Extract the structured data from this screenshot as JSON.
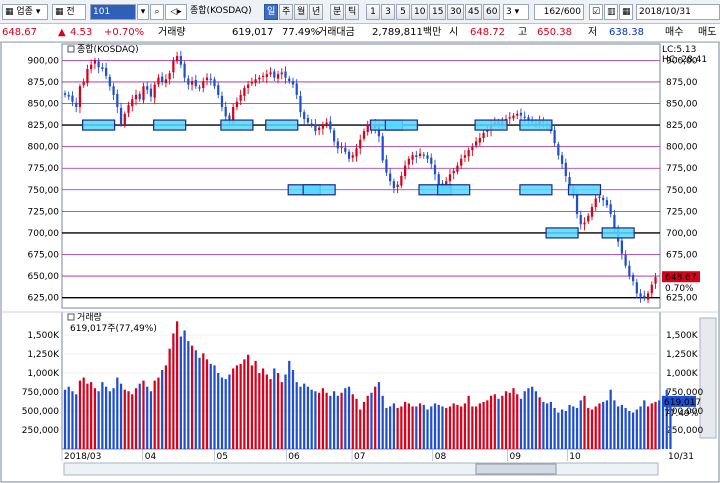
{
  "toolbar": {
    "item1": "업종",
    "item2": "전",
    "code": "101",
    "name": "종합(KOSDAQ)",
    "mode_day": "일",
    "mode_week": "주",
    "mode_month": "월",
    "mode_year": "년",
    "mode_min": "분",
    "mode_tick": "틱",
    "periods": [
      "1",
      "3",
      "5",
      "10",
      "15",
      "30",
      "45",
      "60"
    ],
    "period_select": "3",
    "count": "162",
    "count_total": "/600",
    "date": "2018/10/31"
  },
  "infobar": {
    "price": "648.67",
    "change": "4.53",
    "change_pct": "+0.70%",
    "volume_label": "거래량",
    "volume": "619,017",
    "volume_ratio": "77.49%",
    "amount_label": "거래대금",
    "amount": "2,789,811백만",
    "open_label": "시",
    "open": "648.72",
    "high_label": "고",
    "high": "650.38",
    "low_label": "저",
    "low": "638.38",
    "buy_label": "매수",
    "sell_label": "매도"
  },
  "chart_data": {
    "type": "candlestick",
    "price_panel": {
      "legend": "종합(KOSDAQ)",
      "lc": "LC:5.13",
      "hc": "HC:-28.41",
      "yticks": [
        900,
        875,
        850,
        825,
        800,
        775,
        750,
        725,
        700,
        675,
        650,
        625
      ],
      "ytick_labels": [
        "900,00",
        "875,00",
        "850,00",
        "825,00",
        "800,00",
        "775,00",
        "750,00",
        "725,00",
        "700,00",
        "675,00",
        "650,00",
        "625,00"
      ],
      "ylim": [
        613,
        912
      ],
      "current_price_label": "648.67",
      "current_change_label": "0.70%",
      "support_lines": [
        825,
        700,
        625
      ],
      "grid_lines": [
        900,
        875,
        850,
        800,
        775,
        750,
        725,
        675,
        650
      ],
      "boxes": [
        {
          "center_x": 38,
          "level": 825
        },
        {
          "center_x": 117,
          "level": 825
        },
        {
          "center_x": 189,
          "level": 825
        },
        {
          "center_x": 240,
          "level": 825
        },
        {
          "center_x": 264,
          "level": 750
        },
        {
          "center_x": 284,
          "level": 750
        },
        {
          "center_x": 356,
          "level": 825
        },
        {
          "center_x": 374,
          "level": 825
        },
        {
          "center_x": 410,
          "level": 750
        },
        {
          "center_x": 430,
          "level": 750
        },
        {
          "center_x": 475,
          "level": 825
        },
        {
          "center_x": 525,
          "level": 825
        },
        {
          "center_x": 524,
          "level": 750
        },
        {
          "center_x": 579,
          "level": 750
        },
        {
          "center_x": 554,
          "level": 700
        },
        {
          "center_x": 614,
          "level": 700
        }
      ],
      "closes": [
        860,
        858,
        852,
        846,
        870,
        875,
        890,
        895,
        900,
        892,
        890,
        882,
        870,
        860,
        846,
        826,
        838,
        848,
        855,
        860,
        855,
        870,
        866,
        858,
        872,
        880,
        875,
        878,
        885,
        900,
        905,
        895,
        880,
        872,
        876,
        870,
        868,
        876,
        880,
        878,
        870,
        860,
        846,
        835,
        830,
        846,
        852,
        860,
        868,
        872,
        875,
        878,
        880,
        882,
        884,
        886,
        880,
        884,
        886,
        880,
        876,
        872,
        860,
        840,
        832,
        828,
        826,
        818,
        822,
        825,
        828,
        820,
        806,
        798,
        800,
        794,
        786,
        790,
        798,
        808,
        818,
        826,
        820,
        826,
        812,
        784,
        770,
        760,
        752,
        756,
        766,
        778,
        786,
        790,
        788,
        792,
        790,
        786,
        780,
        768,
        756,
        752,
        760,
        768,
        772,
        778,
        786,
        790,
        796,
        800,
        806,
        810,
        816,
        820,
        826,
        828,
        826,
        830,
        832,
        834,
        836,
        838,
        836,
        834,
        830,
        828,
        826,
        830,
        828,
        826,
        818,
        804,
        790,
        780,
        766,
        752,
        744,
        722,
        710,
        712,
        720,
        730,
        740,
        742,
        738,
        732,
        722,
        706,
        690,
        676,
        662,
        650,
        644,
        630,
        626,
        624,
        630,
        640,
        648.67
      ],
      "volumes": [
        780,
        820,
        760,
        720,
        900,
        940,
        860,
        880,
        800,
        760,
        880,
        820,
        760,
        800,
        940,
        860,
        780,
        760,
        720,
        800,
        860,
        900,
        820,
        760,
        900,
        940,
        1040,
        1100,
        1320,
        1520,
        1680,
        1480,
        1560,
        1420,
        1360,
        1300,
        1200,
        1260,
        1180,
        1120,
        1100,
        1000,
        940,
        920,
        980,
        1060,
        1100,
        1120,
        1180,
        1240,
        1100,
        1160,
        1000,
        1060,
        980,
        920,
        1060,
        1000,
        880,
        980,
        1160,
        1040,
        880,
        820,
        860,
        820,
        780,
        760,
        740,
        800,
        740,
        700,
        760,
        700,
        740,
        800,
        820,
        720,
        660,
        520,
        620,
        700,
        740,
        820,
        880,
        700,
        540,
        560,
        600,
        540,
        560,
        620,
        600,
        560,
        560,
        600,
        580,
        520,
        560,
        600,
        580,
        560,
        540,
        560,
        600,
        580,
        560,
        600,
        700,
        560,
        560,
        600,
        620,
        640,
        700,
        720,
        660,
        700,
        760,
        740,
        800,
        720,
        660,
        760,
        800,
        820,
        760,
        680,
        620,
        600,
        620,
        540,
        480,
        520,
        500,
        580,
        560,
        540,
        640,
        700,
        540,
        520,
        560,
        600,
        620,
        640,
        780,
        640,
        560,
        580,
        540,
        500,
        480,
        520,
        560,
        640,
        560,
        600,
        620,
        640,
        700,
        780,
        619
      ]
    },
    "volume_panel": {
      "legend": "거래량",
      "sub": "619,017주(77,49%)",
      "yticks": [
        1500,
        1250,
        1000,
        750,
        500,
        250
      ],
      "ytick_labels_left": [
        "1,500K",
        "1,250K",
        "1,000K",
        "750,000",
        "500,000",
        "250,000"
      ],
      "ytick_labels_right": [
        "1,500K",
        "1,250K",
        "1,000K",
        "750,000",
        "500,000",
        "250,000"
      ],
      "ylim": [
        0,
        1750
      ],
      "current_volume_label": "619,017",
      "current_ratio_label": "77.49%"
    },
    "x_labels": [
      "2018/03",
      "04",
      "05",
      "06",
      "07",
      "08",
      "09",
      "10",
      "10/31"
    ]
  },
  "colors": {
    "up": "#d9001b",
    "down": "#1f4fd0",
    "grid_purple": "#a020a0",
    "support": "#000000",
    "box_fill": "#55d8ff",
    "box_border": "#1a2a8a",
    "panel_bg": "#ffffff",
    "frame": "#7a8699"
  }
}
